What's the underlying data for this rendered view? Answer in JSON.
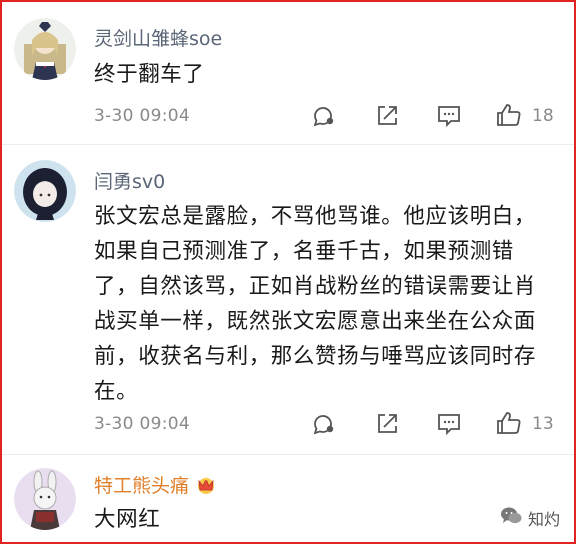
{
  "comments": [
    {
      "username": "灵剑山雏蜂soe",
      "text": "终于翻车了",
      "time": "3-30 09:04",
      "likes": "18"
    },
    {
      "username": "闫勇sv0",
      "text": "张文宏总是露脸，不骂他骂谁。他应该明白，如果自己预测准了，名垂千古，如果预测错了，自然该骂，正如肖战粉丝的错误需要让肖战买单一样，既然张文宏愿意出来坐在公众面前，收获名与利，那么赞扬与唾骂应该同时存在。",
      "time": "3-30 09:04",
      "likes": "13"
    },
    {
      "username": "特工熊头痛",
      "text": "大网红",
      "badge_icon": "crown-badge-icon"
    }
  ],
  "watermark": {
    "text": "知灼"
  },
  "colors": {
    "frame": "#e3231f",
    "username": "#5a6577",
    "vip": "#e0802a",
    "meta": "#8a8a8a"
  }
}
